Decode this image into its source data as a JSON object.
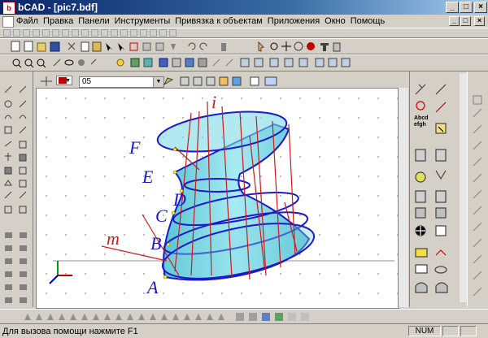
{
  "window": {
    "title": "bCAD - [pic7.bdf]",
    "app_icon": "bcad-app-icon",
    "controls": [
      "_",
      "□",
      "×"
    ]
  },
  "menu": {
    "items": [
      "Файл",
      "Правка",
      "Панели",
      "Инструменты",
      "Привязка к объектам",
      "Приложения",
      "Окно",
      "Помощь"
    ],
    "doc_controls": [
      "_",
      "□",
      "×"
    ]
  },
  "layer_toolbar": {
    "color": "#c00000",
    "layer_value": "05"
  },
  "right_palette": {
    "text_tool_label": "Abcd\nefgh"
  },
  "drawing": {
    "labels": [
      "i",
      "F",
      "E",
      "D",
      "C",
      "B",
      "m",
      "A"
    ],
    "surface_color": "#7fd8e4",
    "edge_color": "#1a1acc",
    "rib_color": "#cc1a1a",
    "point_color": "#ffff00"
  },
  "status": {
    "text": "Для вызова помощи нажмите F1",
    "num": "NUM"
  }
}
